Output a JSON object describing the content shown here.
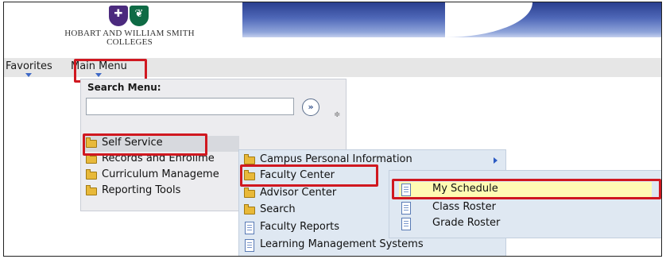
{
  "header": {
    "logo_line1": "HOBART AND WILLIAM SMITH",
    "logo_line2": "COLLEGES"
  },
  "nav": {
    "favorites": "Favorites",
    "main_menu": "Main Menu"
  },
  "search": {
    "label": "Search Menu:",
    "value": "",
    "go_symbol": "»",
    "sort_symbol": "≑"
  },
  "menu_level1": [
    {
      "label": "Self Service",
      "icon": "folder-icon"
    },
    {
      "label": "Records and Enrollme",
      "icon": "folder-icon"
    },
    {
      "label": "Curriculum Manageme",
      "icon": "folder-icon"
    },
    {
      "label": "Reporting Tools",
      "icon": "folder-icon"
    }
  ],
  "menu_level2": [
    {
      "label": "Campus Personal Information",
      "icon": "folder-icon"
    },
    {
      "label": "Faculty Center",
      "icon": "folder-icon"
    },
    {
      "label": "Advisor Center",
      "icon": "folder-icon"
    },
    {
      "label": "Search",
      "icon": "folder-icon"
    },
    {
      "label": "Faculty Reports",
      "icon": "document-icon"
    },
    {
      "label": "Learning Management Systems",
      "icon": "document-icon"
    }
  ],
  "menu_level3": [
    {
      "label": "My Schedule",
      "icon": "document-icon"
    },
    {
      "label": "Class Roster",
      "icon": "document-icon"
    },
    {
      "label": "Grade Roster",
      "icon": "document-icon"
    }
  ],
  "colors": {
    "highlight_box": "#d01820",
    "selected_row_yellow": "#fffbb3",
    "banner": "#2a3f8f",
    "purple_shield": "#4b2a7e",
    "green_shield": "#0f6b45"
  }
}
